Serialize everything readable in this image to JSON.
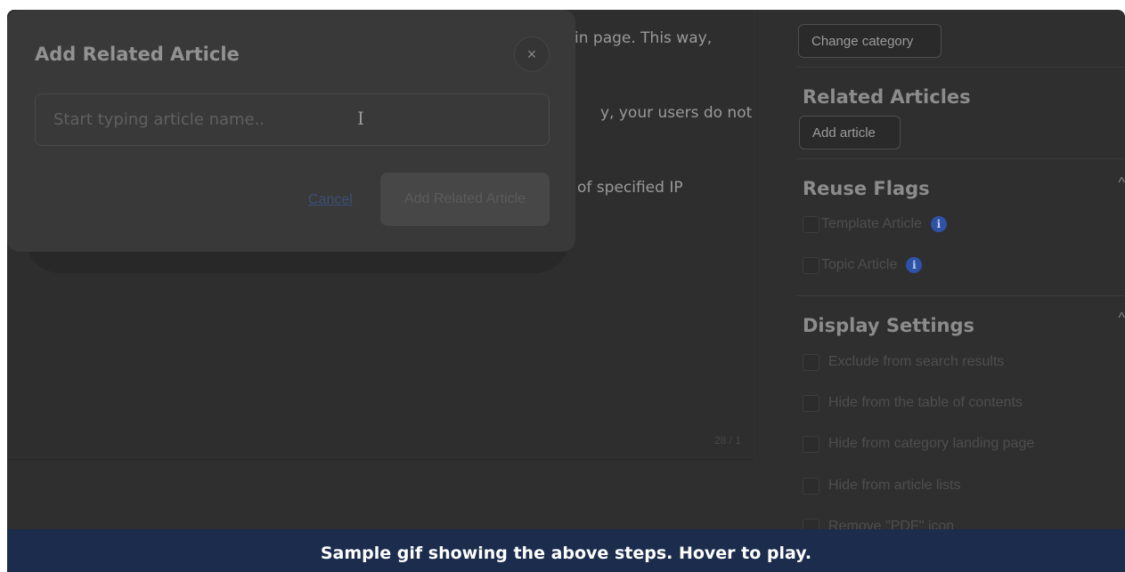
{
  "article": {
    "line1": "in page. This way,",
    "line2": "y, your users do not",
    "line3": "of specified IP",
    "word_count": "28 / 1"
  },
  "panel": {
    "change_category_label": "Change category",
    "related_articles_heading": "Related Articles",
    "add_article_label": "Add article",
    "reuse_flags_heading": "Reuse Flags",
    "reuse_flags": [
      {
        "label": "Template Article"
      },
      {
        "label": "Topic Article"
      }
    ],
    "display_settings_heading": "Display Settings",
    "display_settings": [
      {
        "label": "Exclude from search results"
      },
      {
        "label": "Hide from the table of contents"
      },
      {
        "label": "Hide from category landing page"
      },
      {
        "label": "Hide from article lists"
      },
      {
        "label": "Remove \"PDF\" icon"
      }
    ],
    "info_glyph": "i",
    "chevron_glyph": "^"
  },
  "modal": {
    "title": "Add Related Article",
    "close_glyph": "×",
    "search_placeholder": "Start typing article name..",
    "cursor_glyph": "I",
    "cancel_label": "Cancel",
    "submit_label": "Add Related Article"
  },
  "caption": {
    "text": "Sample gif showing the above steps. Hover to play."
  },
  "colors": {
    "caption_bg": "#1b2c4d",
    "info_icon": "#2d52a6",
    "overlay_dim": "#2f2f2f"
  }
}
